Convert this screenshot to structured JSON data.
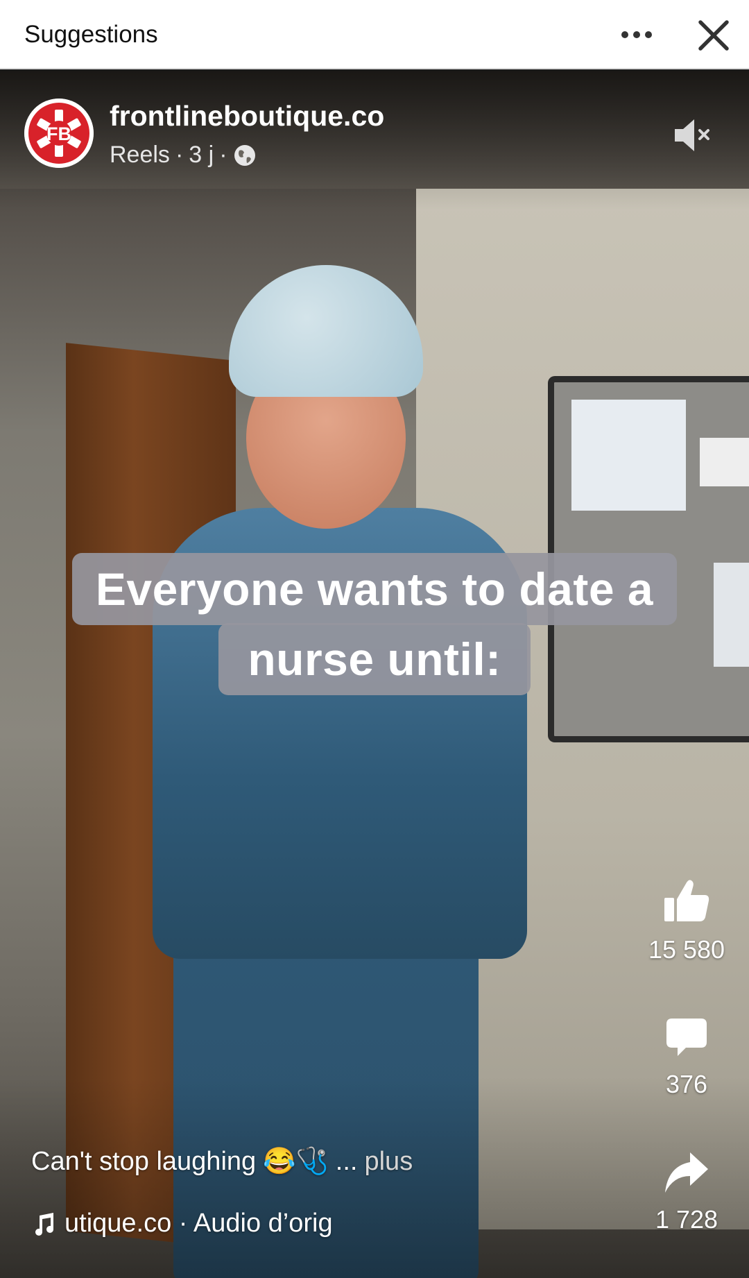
{
  "topbar": {
    "title": "Suggestions"
  },
  "post": {
    "account_name": "frontlineboutique.co",
    "avatar_text": "FB",
    "meta": {
      "type": "Reels",
      "separator": "·",
      "age": "3 j"
    }
  },
  "video": {
    "overlay_line1": "Everyone wants to date a",
    "overlay_line2": "nurse until:"
  },
  "actions": {
    "likes": "15 580",
    "comments": "376",
    "shares": "1 728"
  },
  "caption": {
    "text": "Can't stop laughing",
    "emojis": "😂🩺",
    "ellipsis": "...",
    "more_label": "plus"
  },
  "audio": {
    "label": "utique.co · Audio d’orig"
  },
  "colors": {
    "avatar_red": "#d8222a",
    "topbar_bg": "#ffffff",
    "overlay_box": "#96969e"
  },
  "icons": [
    "more-icon",
    "close-icon",
    "mute-icon",
    "globe-icon",
    "like-icon",
    "comment-icon",
    "share-icon",
    "music-note-icon"
  ]
}
